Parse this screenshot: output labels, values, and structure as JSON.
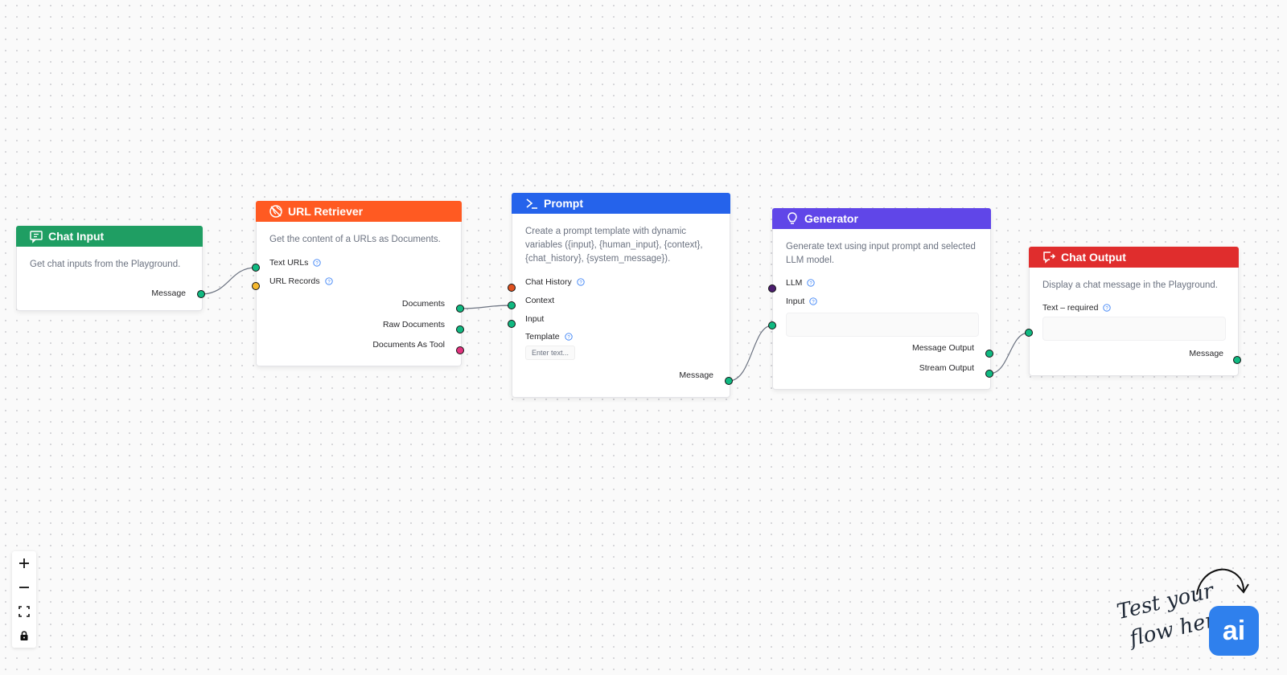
{
  "nodes": {
    "chat_input": {
      "title": "Chat Input",
      "color": "#1f9e63",
      "description": "Get chat inputs from the Playground.",
      "outputs": [
        "Message"
      ]
    },
    "url_retriever": {
      "title": "URL Retriever",
      "color": "#ff5a22",
      "description": "Get the content of a URLs as Documents.",
      "inputs": [
        "Text URLs",
        "URL Records"
      ],
      "outputs": [
        "Documents",
        "Raw Documents",
        "Documents As Tool"
      ]
    },
    "prompt": {
      "title": "Prompt",
      "color": "#2563eb",
      "description": "Create a prompt template with dynamic variables ({input}, {human_input}, {context}, {chat_history}, {system_message}).",
      "inputs": [
        "Chat History",
        "Context",
        "Input",
        "Template"
      ],
      "template_placeholder": "Enter text...",
      "outputs": [
        "Message"
      ]
    },
    "generator": {
      "title": "Generator",
      "color": "#6046e8",
      "description": "Generate text using input prompt and selected LLM model.",
      "inputs": [
        "LLM",
        "Input"
      ],
      "outputs": [
        "Message Output",
        "Stream Output"
      ]
    },
    "chat_output": {
      "title": "Chat Output",
      "color": "#e02d2d",
      "description": "Display a chat message in the Playground.",
      "inputs": [
        "Text – required"
      ],
      "outputs": [
        "Message"
      ]
    }
  },
  "handle_colors": {
    "message": "#10b981",
    "records": "#f5b82e",
    "chat_history": "#e0511f",
    "tool": "#e2327e",
    "llm": "#4c1d6f"
  },
  "canvas_controls": [
    "zoom-in-icon",
    "zoom-out-icon",
    "fit-view-icon",
    "lock-icon"
  ],
  "hint": {
    "line1": "Test your",
    "line2": "flow here"
  },
  "assistant_button": {
    "label": "ai"
  }
}
